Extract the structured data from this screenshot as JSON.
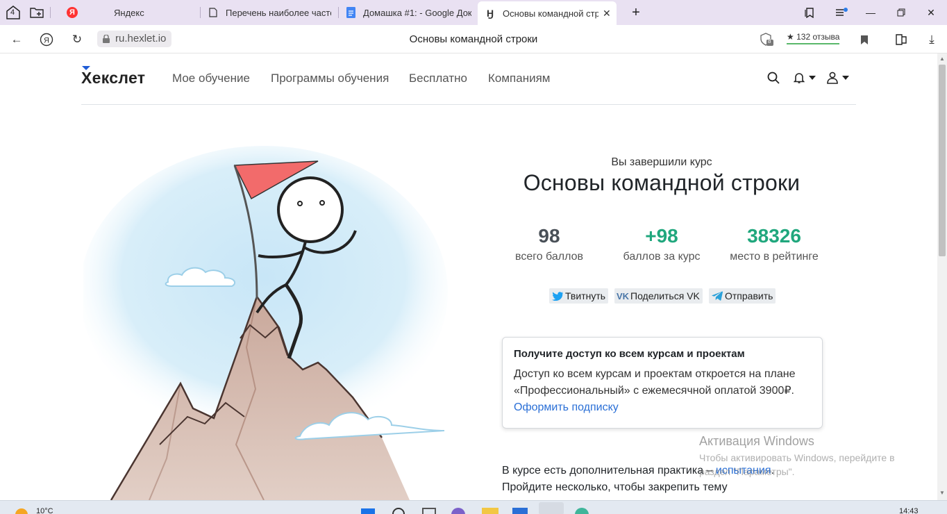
{
  "browser": {
    "tab_counter": "4",
    "tabs": [
      {
        "title": "Яндекс",
        "icon": "yandex-icon"
      },
      {
        "title": "Перечень наиболее часто",
        "icon": "document-icon"
      },
      {
        "title": "Домашка #1: - Google Док",
        "icon": "google-docs-icon"
      },
      {
        "title": "Основы командной стр",
        "icon": "hexlet-icon",
        "active": true
      }
    ],
    "url": "ru.hexlet.io",
    "page_title": "Основы командной строки",
    "protect_badge": "8",
    "reviews": "132 отзыва"
  },
  "site": {
    "logo": "Хекслет",
    "menu": [
      "Мое обучение",
      "Программы обучения",
      "Бесплатно",
      "Компаниям"
    ]
  },
  "result": {
    "done_label": "Вы завершили курс",
    "course_title": "Основы командной строки",
    "stats": [
      {
        "value": "98",
        "label": "всего баллов",
        "color": "#495057"
      },
      {
        "value": "+98",
        "label": "баллов за курс",
        "color": "#20a77d"
      },
      {
        "value": "38326",
        "label": "место в рейтинге",
        "color": "#20a77d"
      }
    ],
    "share": [
      {
        "label": "Твитнуть",
        "icon": "twitter-icon"
      },
      {
        "label": "Поделиться VK",
        "icon": "vk-icon"
      },
      {
        "label": "Отправить",
        "icon": "telegram-icon"
      }
    ]
  },
  "subscription_card": {
    "title": "Получите доступ ко всем курсам и проектам",
    "text": "Доступ ко всем курсам и проектам откроется на плане «Профессиональный» с ежемесячной оплатой 3900₽.",
    "link": "Оформить подписку"
  },
  "practice": {
    "text_before": "В курсе есть дополнительная практика – ",
    "link": "испытания",
    "text_after": ".",
    "line2": "Пройдите несколько, чтобы закрепить тему"
  },
  "watermark": {
    "title": "Активация Windows",
    "subtitle": "Чтобы активировать Windows, перейдите в раздел \"Параметры\"."
  },
  "taskbar": {
    "weather": "10°C",
    "time": "14:43"
  },
  "colors": {
    "accent_green": "#20a77d",
    "link_blue": "#2a6fd6",
    "tabbar_bg": "#e9e1f2"
  }
}
